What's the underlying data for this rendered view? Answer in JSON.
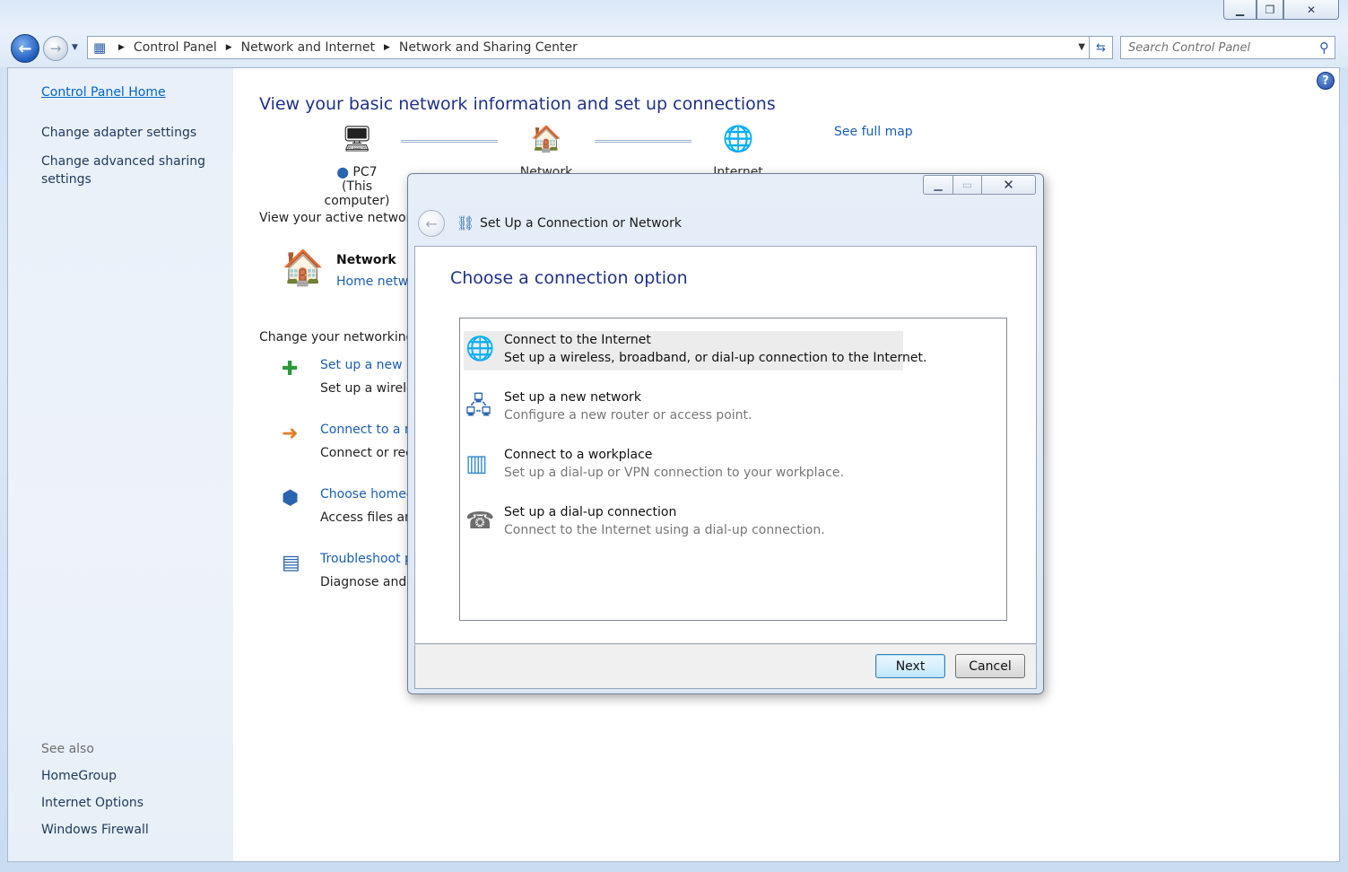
{
  "window": {
    "minimize_icon": "minimize-icon",
    "maximize_icon": "restore-icon",
    "close_icon": "close-icon"
  },
  "nav": {
    "breadcrumbs": [
      "Control Panel",
      "Network and Internet",
      "Network and Sharing Center"
    ],
    "search_placeholder": "Search Control Panel"
  },
  "sidebar": {
    "home": "Control Panel Home",
    "adapter": "Change adapter settings",
    "advanced": "Change advanced sharing settings",
    "see_also": "See also",
    "links": [
      "HomeGroup",
      "Internet Options",
      "Windows Firewall"
    ]
  },
  "main": {
    "title": "View your basic network information and set up connections",
    "map": {
      "computer_name": "PC7",
      "computer_sub": "(This computer)",
      "network_label": "Network",
      "internet_label": "Internet",
      "see_full_map": "See full map"
    },
    "active_networks_label": "View your active network",
    "active_network": {
      "name": "Network",
      "type": "Home netwo"
    },
    "change_settings_label": "Change your networking",
    "tasks": [
      {
        "link": "Set up a new c",
        "desc": "Set up a wirele"
      },
      {
        "link": "Connect to a ne",
        "desc": "Connect or rec"
      },
      {
        "link": "Choose homeg",
        "desc": "Access files anc"
      },
      {
        "link": "Troubleshoot p",
        "desc": "Diagnose and r"
      }
    ]
  },
  "dialog": {
    "title": "Set Up a Connection or Network",
    "heading": "Choose a connection option",
    "options": [
      {
        "title": "Connect to the Internet",
        "desc": "Set up a wireless, broadband, or dial-up connection to the Internet.",
        "icon": "globe-connect-icon",
        "selected": true
      },
      {
        "title": "Set up a new network",
        "desc": "Configure a new router or access point.",
        "icon": "new-network-icon",
        "selected": false
      },
      {
        "title": "Connect to a workplace",
        "desc": "Set up a dial-up or VPN connection to your workplace.",
        "icon": "workplace-icon",
        "selected": false
      },
      {
        "title": "Set up a dial-up connection",
        "desc": "Connect to the Internet using a dial-up connection.",
        "icon": "dialup-phone-icon",
        "selected": false
      }
    ],
    "next_label": "Next",
    "cancel_label": "Cancel"
  },
  "colors": {
    "title_blue": "#1e3287",
    "link_blue": "#1a5eb3",
    "sidebar_bg": "#e9f0f9"
  }
}
